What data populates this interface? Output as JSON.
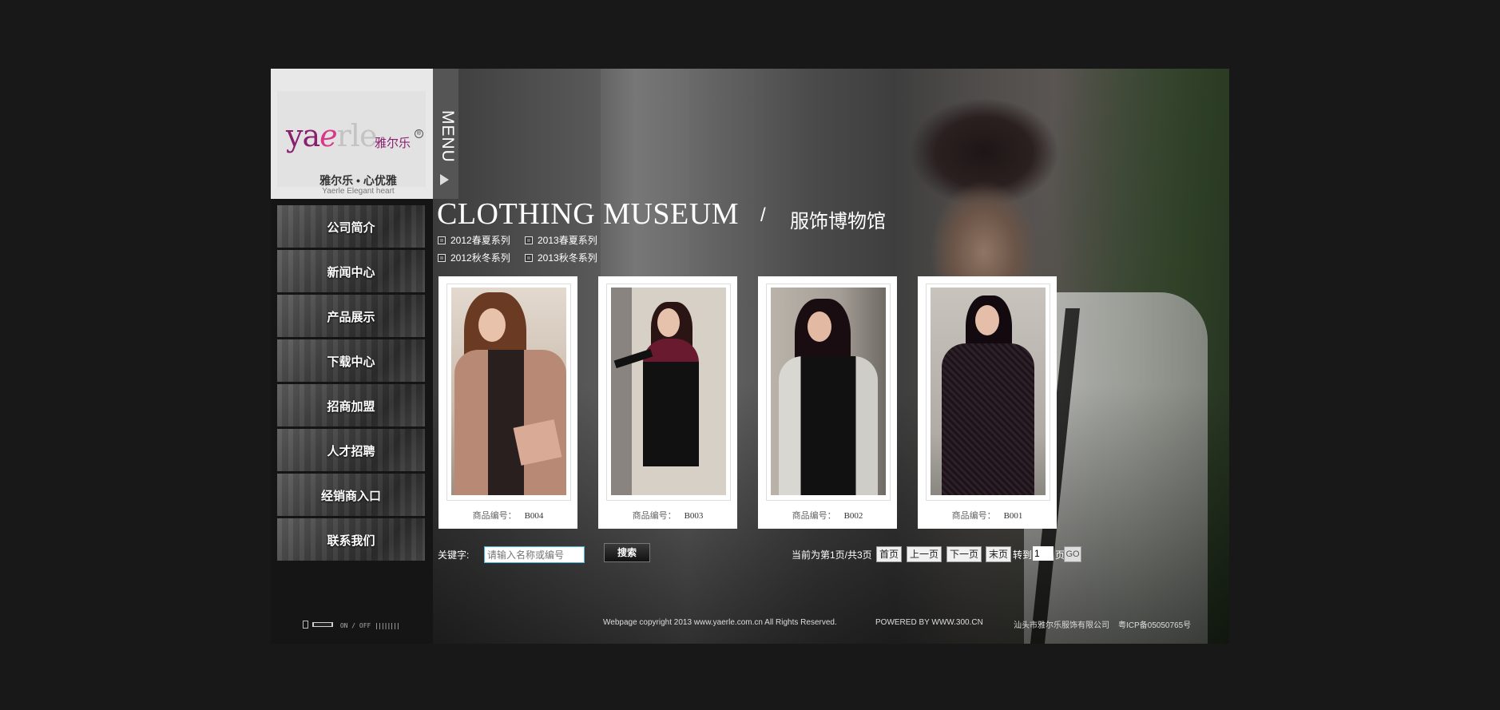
{
  "brand": {
    "logo_text_parts": [
      "ya",
      "e",
      "rle"
    ],
    "logo_cn": "雅尔乐",
    "registered_mark": "®",
    "slogan": "雅尔乐 • 心优雅",
    "slogan_en": "Yaerle Elegant heart"
  },
  "menu_tab": {
    "label": "MENU",
    "icon": "triangle-right-icon"
  },
  "nav": {
    "items": [
      {
        "label": "公司简介"
      },
      {
        "label": "新闻中心"
      },
      {
        "label": "产品展示"
      },
      {
        "label": "下载中心"
      },
      {
        "label": "招商加盟"
      },
      {
        "label": "人才招聘"
      },
      {
        "label": "经销商入口"
      },
      {
        "label": "联系我们"
      }
    ]
  },
  "audio": {
    "icon": "speaker-icon",
    "status": "ON / OFF",
    "bars": "||||||||"
  },
  "heading": {
    "title_en": "CLOTHING MUSEUM",
    "separator": "/",
    "title_cn": "服饰博物馆"
  },
  "series": {
    "items": [
      {
        "label": "2012春夏系列"
      },
      {
        "label": "2013春夏系列"
      },
      {
        "label": "2012秋冬系列"
      },
      {
        "label": "2013秋冬系列"
      }
    ]
  },
  "products": {
    "caption_label": "商品编号：",
    "items": [
      {
        "code": "B004"
      },
      {
        "code": "B003"
      },
      {
        "code": "B002"
      },
      {
        "code": "B001"
      }
    ]
  },
  "search": {
    "label": "关键字:",
    "placeholder": "请输入名称或编号",
    "button": "搜索"
  },
  "pager": {
    "status": "当前为第1页/共3页",
    "first": "首页",
    "prev": "上一页",
    "next": "下一页",
    "last": "末页",
    "goto_label": "转到",
    "page_value": "1",
    "page_unit": "页",
    "go": "GO"
  },
  "footer": {
    "copyright": "Webpage copyright 2013 www.yaerle.com.cn All Rights Reserved.",
    "powered": "POWERED BY WWW.300.CN",
    "company": "汕头市雅尔乐服饰有限公司",
    "icp": "粤ICP备05050765号"
  },
  "colors": {
    "background": "#181818",
    "logo_brand": "#8a1f6e",
    "input_border": "#4fb7d9"
  }
}
